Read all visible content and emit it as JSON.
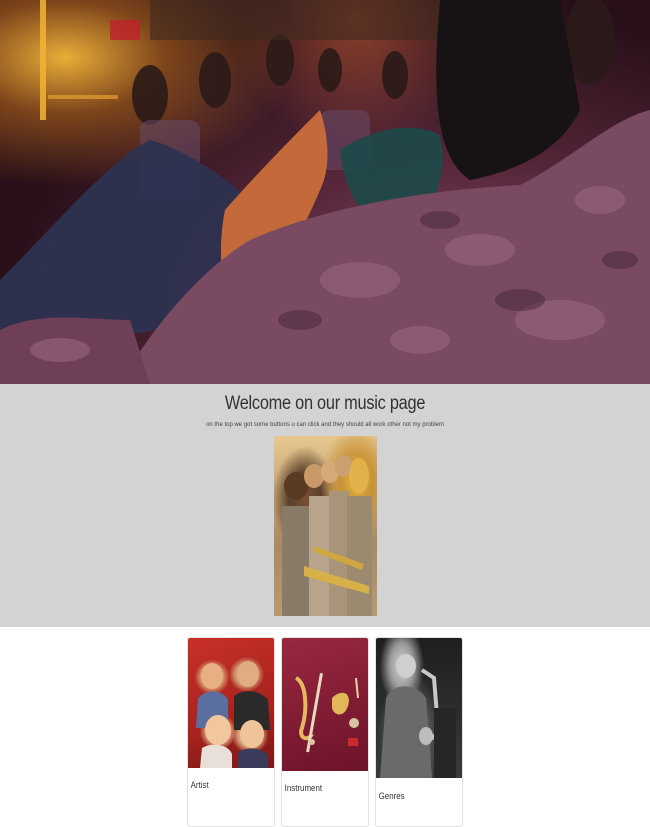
{
  "hero": {
    "image": "concert-crowd-photo"
  },
  "welcome": {
    "title": "Welcome on our music page",
    "subtitle": "on the top we got some buttons u can click and they should all work other not my problem",
    "image": "band-trumpet-photo"
  },
  "cards": [
    {
      "title": "Artist",
      "image": "artist-group-photo"
    },
    {
      "title": "Instrument",
      "image": "instruments-illustration"
    },
    {
      "title": "Genres",
      "image": "saxophonist-photo"
    }
  ],
  "colors": {
    "band_background": "#d3d3d3",
    "page_background": "#ffffff",
    "card_border": "#e2e2e2"
  }
}
